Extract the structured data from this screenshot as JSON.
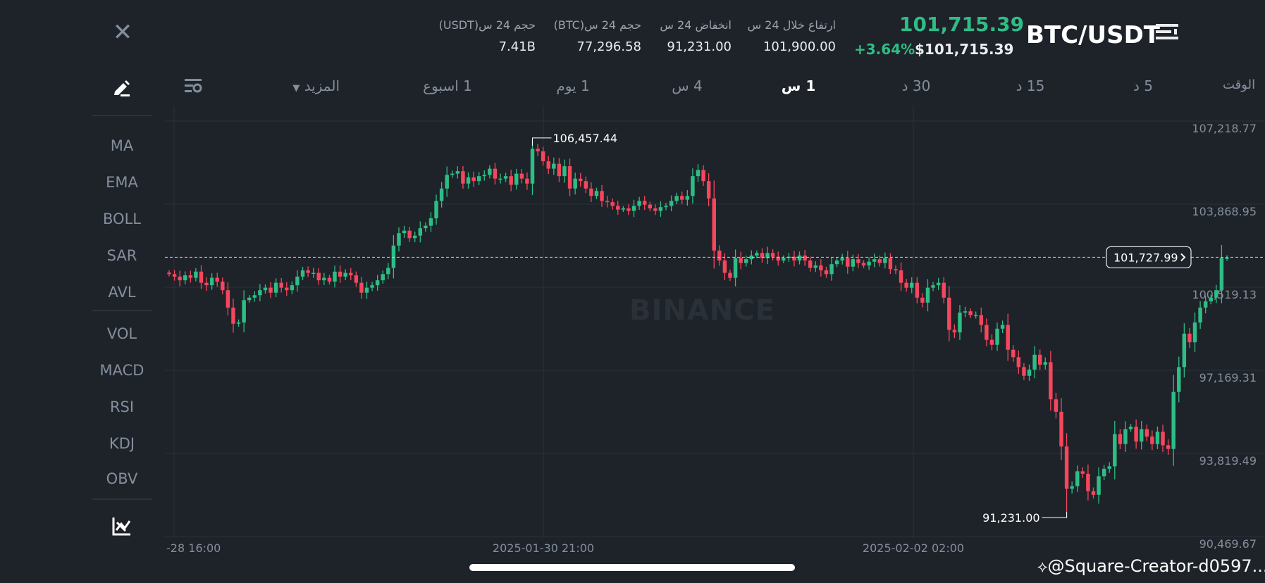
{
  "header": {
    "close_icon": "close-icon",
    "stats": [
      {
        "label": "حجم 24 س(USDT)",
        "value": "7.41B"
      },
      {
        "label": "حجم 24 س(BTC)",
        "value": "77,296.58"
      },
      {
        "label": "انخفاض 24 س",
        "value": "91,231.00"
      },
      {
        "label": "ارتفاع خلال 24 س",
        "value": "101,900.00"
      }
    ],
    "price": "101,715.39",
    "change": "+3.64%",
    "price_usd": "$101,715.39",
    "pair": "BTC/USDT",
    "menu_icon": "menu-icon"
  },
  "toolbar": {
    "settings_icon": "indicator-settings-icon",
    "more": "المزيد",
    "intervals": [
      "1 اسبوع",
      "1 يوم",
      "4 س",
      "1 س",
      "30 د",
      "15 د",
      "5 د"
    ],
    "active": "1 س",
    "time_label": "الوقت",
    "draw_icon": "pen-draw-icon"
  },
  "sidebar": {
    "main_indicators": [
      "MA",
      "EMA",
      "BOLL",
      "SAR",
      "AVL"
    ],
    "sub_indicators": [
      "VOL",
      "MACD",
      "RSI",
      "KDJ",
      "OBV"
    ],
    "bottom_icon": "chart-toggle-icon"
  },
  "chart_data": {
    "type": "candlestick",
    "title": "",
    "ylim": [
      90469.67,
      107218.77
    ],
    "y_ticks": [
      "107,218.77",
      "103,868.95",
      "100,519.13",
      "97,169.31",
      "93,819.49",
      "90,469.67"
    ],
    "x_ticks": [
      "-28 16:00",
      "2025-01-30 21:00",
      "2025-02-02 02:00"
    ],
    "annotations": {
      "high": "106,457.44",
      "low": "91,231.00",
      "last": "101,727.99"
    },
    "last_price": 101727.99,
    "colors": {
      "up": "#2ebd85",
      "down": "#f6465d",
      "grid": "#2b3139",
      "axis_text": "#848e9c"
    },
    "closes": [
      101050,
      100950,
      100800,
      101000,
      100900,
      101150,
      100700,
      100600,
      100900,
      100750,
      100400,
      99700,
      99050,
      99100,
      100000,
      100100,
      100200,
      100400,
      100500,
      100300,
      100700,
      100500,
      100400,
      100600,
      100950,
      101200,
      101100,
      101100,
      100800,
      100900,
      100750,
      101150,
      100950,
      101100,
      101000,
      100700,
      100300,
      100500,
      100600,
      100800,
      101050,
      101300,
      102200,
      102700,
      102800,
      102500,
      102600,
      102900,
      103000,
      103300,
      104000,
      104500,
      105050,
      105100,
      105200,
      104700,
      104950,
      104800,
      105000,
      105050,
      105300,
      104900,
      104900,
      105000,
      104650,
      105100,
      104900,
      104700,
      106100,
      106000,
      105600,
      105300,
      105500,
      105000,
      105400,
      104500,
      104900,
      104800,
      104500,
      104200,
      104400,
      104000,
      103950,
      103800,
      103650,
      103700,
      103600,
      103800,
      104000,
      103850,
      103700,
      103600,
      103750,
      103800,
      104000,
      104200,
      104050,
      104200,
      105000,
      105250,
      104800,
      104100,
      102000,
      101600,
      101100,
      100900,
      101700,
      101500,
      101650,
      101800,
      101900,
      101700,
      101900,
      101750,
      101600,
      101700,
      101750,
      101600,
      101800,
      101600,
      101300,
      101400,
      101200,
      101050,
      101450,
      101600,
      101700,
      101350,
      101650,
      101500,
      101400,
      101550,
      101650,
      101500,
      101700,
      101250,
      101200,
      100700,
      100500,
      100700,
      100100,
      99900,
      100500,
      100600,
      100700,
      100100,
      98800,
      98700,
      99500,
      99550,
      99400,
      99400,
      99000,
      98400,
      98200,
      98850,
      99000,
      98000,
      97700,
      97300,
      96950,
      97200,
      97800,
      97400,
      97500,
      96000,
      95500,
      94100,
      92400,
      92500,
      93100,
      93000,
      92300,
      92150,
      92900,
      93200,
      93300,
      94600,
      94200,
      94800,
      94900,
      94300,
      94800,
      94500,
      94200,
      94700,
      94150,
      94000,
      96300,
      97300,
      98650,
      98300,
      99100,
      99700,
      99950,
      100100,
      100400,
      101700,
      101700
    ]
  },
  "watermark": "BINANCE",
  "credit": "@Square-Creator-d0597..."
}
